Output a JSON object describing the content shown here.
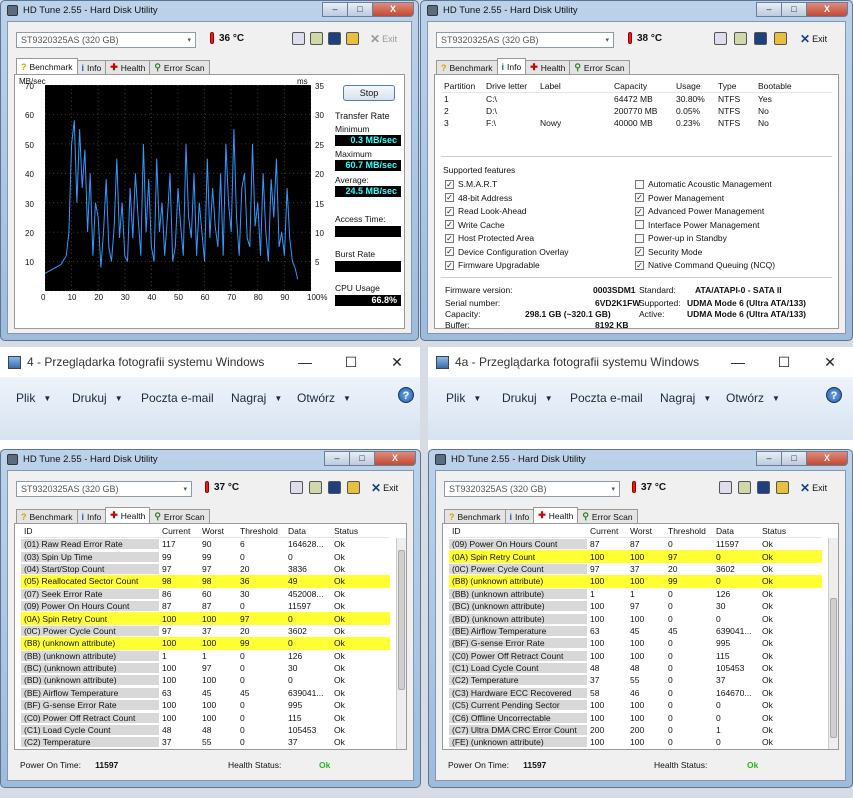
{
  "app": {
    "title": "HD Tune 2.55 - Hard Disk Utility"
  },
  "win_buttons": {
    "min": "‒",
    "max": "□",
    "close": "X"
  },
  "toolbar": {
    "drive": "ST9320325AS (320 GB)",
    "exit": "Exit",
    "dd": "▾"
  },
  "tabs": {
    "benchmark": "Benchmark",
    "info": "Info",
    "health": "Health",
    "error_scan": "Error Scan"
  },
  "win1": {
    "temp": "36 °C"
  },
  "win2": {
    "temp": "38 °C"
  },
  "win3": {
    "temp": "37 °C"
  },
  "win4": {
    "temp": "37 °C"
  },
  "benchmark": {
    "unit_left": "MB/sec",
    "unit_right": "ms",
    "stop": "Stop",
    "transfer_rate": "Transfer Rate",
    "minimum_label": "Minimum",
    "minimum": "0.3 MB/sec",
    "maximum_label": "Maximum",
    "maximum": "60.7 MB/sec",
    "average_label": "Average:",
    "average": "24.5 MB/sec",
    "access_label": "Access Time:",
    "burst_label": "Burst Rate",
    "cpu_label": "CPU Usage",
    "cpu": "66.8%",
    "y_left": [
      "70",
      "60",
      "50",
      "40",
      "30",
      "20",
      "10"
    ],
    "y_right": [
      "35",
      "30",
      "25",
      "20",
      "15",
      "10",
      "5"
    ],
    "x_ticks": [
      "0",
      "10",
      "20",
      "30",
      "40",
      "50",
      "60",
      "70",
      "80",
      "90",
      "100%"
    ]
  },
  "chart_data": {
    "type": "line",
    "title": "",
    "xlabel": "",
    "ylabel": "MB/sec",
    "xlim": [
      0,
      100
    ],
    "ylim": [
      0,
      70
    ],
    "x": [
      0,
      2,
      4,
      6,
      8,
      9,
      10,
      11,
      12,
      13,
      14,
      15,
      16,
      17,
      18,
      19,
      20,
      21,
      22,
      23,
      24,
      25,
      26,
      27,
      28,
      29,
      30,
      31,
      32,
      33,
      34,
      35,
      36,
      37,
      38,
      39,
      40,
      41,
      42,
      43,
      44,
      45,
      46,
      47,
      48,
      49,
      50,
      51,
      52,
      53,
      54,
      55,
      56,
      57,
      58,
      59,
      60,
      61,
      62,
      63,
      64,
      65,
      66,
      67,
      68,
      69,
      70,
      71,
      72,
      73,
      74,
      75,
      76,
      77,
      78,
      79,
      80,
      81,
      82,
      83,
      84,
      85,
      86,
      87,
      88,
      89,
      90,
      91,
      92,
      93,
      94,
      95
    ],
    "series": [
      {
        "name": "",
        "values": [
          6,
          7,
          8,
          9,
          12,
          20,
          50,
          58,
          30,
          55,
          35,
          48,
          20,
          40,
          12,
          30,
          25,
          8,
          20,
          38,
          15,
          10,
          22,
          45,
          18,
          30,
          12,
          10,
          35,
          18,
          40,
          25,
          12,
          50,
          20,
          38,
          15,
          10,
          45,
          20,
          30,
          12,
          25,
          40,
          10,
          15,
          35,
          22,
          12,
          50,
          25,
          18,
          40,
          12,
          30,
          20,
          10,
          45,
          18,
          35,
          22,
          15,
          40,
          12,
          50,
          30,
          20,
          55,
          25,
          12,
          35,
          40,
          18,
          15,
          50,
          22,
          30,
          12,
          40,
          20,
          10,
          38,
          25,
          45,
          15,
          20,
          12,
          35,
          18,
          10,
          8,
          4
        ]
      }
    ]
  },
  "info": {
    "part_cols": [
      "Partition",
      "Drive letter",
      "Label",
      "Capacity",
      "Usage",
      "Type",
      "Bootable"
    ],
    "partitions": [
      [
        "1",
        "C:\\",
        "",
        "64472 MB",
        "30.80%",
        "NTFS",
        "Yes"
      ],
      [
        "2",
        "D:\\",
        "",
        "200770 MB",
        "0.05%",
        "NTFS",
        "No"
      ],
      [
        "3",
        "F:\\",
        "Nowy",
        "40000 MB",
        "0.23%",
        "NTFS",
        "No"
      ]
    ],
    "supported": "Supported features",
    "features_left": [
      "S.M.A.R.T",
      "48-bit Address",
      "Read Look-Ahead",
      "Write Cache",
      "Host Protected Area",
      "Device Configuration Overlay",
      "Firmware Upgradable"
    ],
    "features_right": [
      "Automatic Acoustic Management",
      "Power Management",
      "Advanced Power Management",
      "Interface Power Management",
      "Power-up in Standby",
      "Security Mode",
      "Native Command Queuing (NCQ)"
    ],
    "checked_left": [
      true,
      true,
      true,
      true,
      true,
      true,
      true
    ],
    "checked_right": [
      false,
      true,
      true,
      false,
      false,
      true,
      true
    ],
    "fw_label": "Firmware version:",
    "fw": "0003SDM1",
    "sn_label": "Serial number:",
    "sn": "6VD2K1FW",
    "cap_label": "Capacity:",
    "cap": "298.1 GB (~320.1 GB)",
    "buf_label": "Buffer:",
    "buf": "8192 KB",
    "std_label": "Standard:",
    "std": "ATA/ATAPI-0 - SATA II",
    "sup_label": "Supported:",
    "sup": "UDMA Mode 6 (Ultra ATA/133)",
    "act_label": "Active:",
    "act": "UDMA Mode 6 (Ultra ATA/133)"
  },
  "health_cols": [
    "ID",
    "Current",
    "Worst",
    "Threshold",
    "Data",
    "Status"
  ],
  "health3": [
    [
      "(01) Raw Read Error Rate",
      "117",
      "90",
      "6",
      "164628...",
      "Ok",
      false
    ],
    [
      "(03) Spin Up Time",
      "99",
      "99",
      "0",
      "0",
      "Ok",
      false
    ],
    [
      "(04) Start/Stop Count",
      "97",
      "97",
      "20",
      "3836",
      "Ok",
      false
    ],
    [
      "(05) Reallocated Sector Count",
      "98",
      "98",
      "36",
      "49",
      "Ok",
      true
    ],
    [
      "(07) Seek Error Rate",
      "86",
      "60",
      "30",
      "452008...",
      "Ok",
      false
    ],
    [
      "(09) Power On Hours Count",
      "87",
      "87",
      "0",
      "11597",
      "Ok",
      false
    ],
    [
      "(0A) Spin Retry Count",
      "100",
      "100",
      "97",
      "0",
      "Ok",
      true
    ],
    [
      "(0C) Power Cycle Count",
      "97",
      "37",
      "20",
      "3602",
      "Ok",
      false
    ],
    [
      "(B8) (unknown attribute)",
      "100",
      "100",
      "99",
      "0",
      "Ok",
      true
    ],
    [
      "(BB) (unknown attribute)",
      "1",
      "1",
      "0",
      "126",
      "Ok",
      false
    ],
    [
      "(BC) (unknown attribute)",
      "100",
      "97",
      "0",
      "30",
      "Ok",
      false
    ],
    [
      "(BD) (unknown attribute)",
      "100",
      "100",
      "0",
      "0",
      "Ok",
      false
    ],
    [
      "(BE) Airflow Temperature",
      "63",
      "45",
      "45",
      "639041...",
      "Ok",
      false
    ],
    [
      "(BF) G-sense Error Rate",
      "100",
      "100",
      "0",
      "995",
      "Ok",
      false
    ],
    [
      "(C0) Power Off Retract Count",
      "100",
      "100",
      "0",
      "115",
      "Ok",
      false
    ],
    [
      "(C1) Load Cycle Count",
      "48",
      "48",
      "0",
      "105453",
      "Ok",
      false
    ],
    [
      "(C2) Temperature",
      "37",
      "55",
      "0",
      "37",
      "Ok",
      false
    ]
  ],
  "health4": [
    [
      "(09) Power On Hours Count",
      "87",
      "87",
      "0",
      "11597",
      "Ok",
      false
    ],
    [
      "(0A) Spin Retry Count",
      "100",
      "100",
      "97",
      "0",
      "Ok",
      true
    ],
    [
      "(0C) Power Cycle Count",
      "97",
      "37",
      "20",
      "3602",
      "Ok",
      false
    ],
    [
      "(B8) (unknown attribute)",
      "100",
      "100",
      "99",
      "0",
      "Ok",
      true
    ],
    [
      "(BB) (unknown attribute)",
      "1",
      "1",
      "0",
      "126",
      "Ok",
      false
    ],
    [
      "(BC) (unknown attribute)",
      "100",
      "97",
      "0",
      "30",
      "Ok",
      false
    ],
    [
      "(BD) (unknown attribute)",
      "100",
      "100",
      "0",
      "0",
      "Ok",
      false
    ],
    [
      "(BE) Airflow Temperature",
      "63",
      "45",
      "45",
      "639041...",
      "Ok",
      false
    ],
    [
      "(BF) G-sense Error Rate",
      "100",
      "100",
      "0",
      "995",
      "Ok",
      false
    ],
    [
      "(C0) Power Off Retract Count",
      "100",
      "100",
      "0",
      "115",
      "Ok",
      false
    ],
    [
      "(C1) Load Cycle Count",
      "48",
      "48",
      "0",
      "105453",
      "Ok",
      false
    ],
    [
      "(C2) Temperature",
      "37",
      "55",
      "0",
      "37",
      "Ok",
      false
    ],
    [
      "(C3) Hardware ECC Recovered",
      "58",
      "46",
      "0",
      "164670...",
      "Ok",
      false
    ],
    [
      "(C5) Current Pending Sector",
      "100",
      "100",
      "0",
      "0",
      "Ok",
      false
    ],
    [
      "(C6) Offline Uncorrectable",
      "100",
      "100",
      "0",
      "0",
      "Ok",
      false
    ],
    [
      "(C7) Ultra DMA CRC Error Count",
      "200",
      "200",
      "0",
      "1",
      "Ok",
      false
    ],
    [
      "(FE) (unknown attribute)",
      "100",
      "100",
      "0",
      "0",
      "Ok",
      false
    ]
  ],
  "health_status": {
    "power_on_label": "Power On Time:",
    "power_on": "11597",
    "status_label": "Health Status:",
    "status": "Ok"
  },
  "photo1": {
    "title": "4 - Przeglądarka fotografii systemu Windows"
  },
  "photo2": {
    "title": "4a - Przeglądarka fotografii systemu Windows"
  },
  "photo_menu": [
    "Plik",
    "Drukuj",
    "Poczta e-mail",
    "Nagraj",
    "Otwórz"
  ],
  "photo_ctrl": {
    "min": "—",
    "max": "☐",
    "close": "✕",
    "help": "?"
  },
  "colors": {
    "highlight": "#ffff33",
    "ok": "#22bb22",
    "chart_line": "#3399ff",
    "value_cyan": "#33ffff"
  }
}
